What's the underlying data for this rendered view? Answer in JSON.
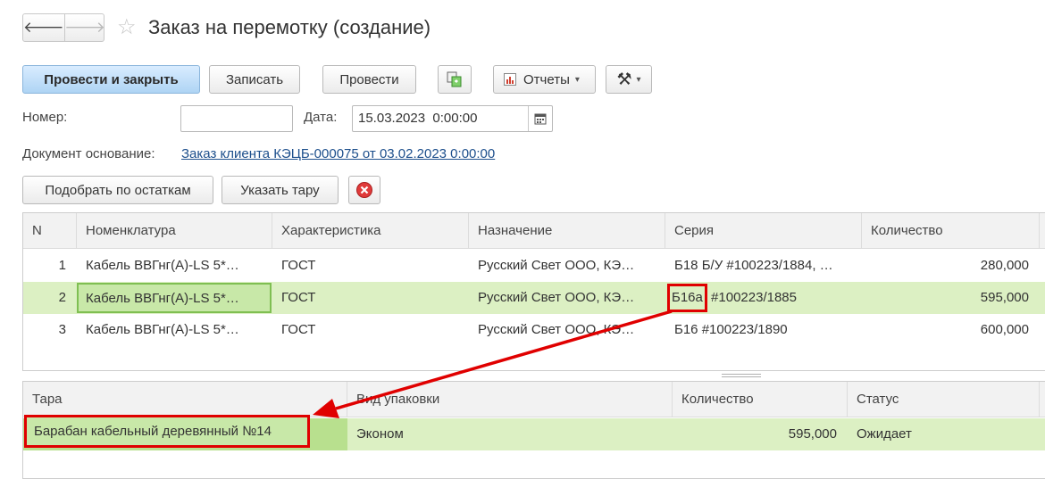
{
  "window": {
    "title": "Заказ на перемотку (создание)"
  },
  "nav": {
    "back_glyph": "🡐",
    "forward_glyph": "🡒",
    "star_glyph": "☆"
  },
  "toolbar": {
    "post_close": "Провести и закрыть",
    "save": "Записать",
    "post": "Провести",
    "reports": "Отчеты",
    "dropdown_glyph": "▾",
    "tools_glyph": "⚒"
  },
  "form": {
    "number_label": "Номер:",
    "number_value": "",
    "date_label": "Дата:",
    "date_value": "15.03.2023  0:00:00",
    "basis_label": "Документ основание:",
    "basis_link": "Заказ клиента КЭЦБ-000075 от 03.02.2023 0:00:00"
  },
  "actions": {
    "pick_by_stock": "Подобрать по остаткам",
    "specify_tare": "Указать тару"
  },
  "main_table": {
    "headers": [
      "N",
      "Номенклатура",
      "Характеристика",
      "Назначение",
      "Серия",
      "Количество"
    ],
    "rows": [
      {
        "n": "1",
        "item": "Кабель ВВГнг(А)-LS 5*…",
        "characteristic": "ГОСТ",
        "purpose": "Русский Свет ООО, КЭ…",
        "series": "Б18 Б/У #100223/1884, …",
        "qty": "280,000"
      },
      {
        "n": "2",
        "item": "Кабель ВВГнг(А)-LS 5*…",
        "characteristic": "ГОСТ",
        "purpose": "Русский Свет ООО, КЭ…",
        "series_prefix": "Б16а",
        "series_rest": " #100223/1885",
        "qty": "595,000"
      },
      {
        "n": "3",
        "item": "Кабель ВВГнг(А)-LS 5*…",
        "characteristic": "ГОСТ",
        "purpose": "Русский Свет ООО, КЭ…",
        "series": "Б16 #100223/1890",
        "qty": "600,000"
      }
    ],
    "selected_row": 2
  },
  "tare_table": {
    "headers": [
      "Тара",
      "Вид упаковки",
      "Количество",
      "Статус"
    ],
    "rows": [
      {
        "tare": "Барабан кабельный деревянный №14",
        "packaging": "Эконом",
        "qty": "595,000",
        "status": "Ожидает"
      }
    ]
  },
  "colors": {
    "accent": "#aed4f4",
    "selection": "#dcf0c3",
    "link": "#1d4f8c",
    "annotation": "#e00000"
  }
}
